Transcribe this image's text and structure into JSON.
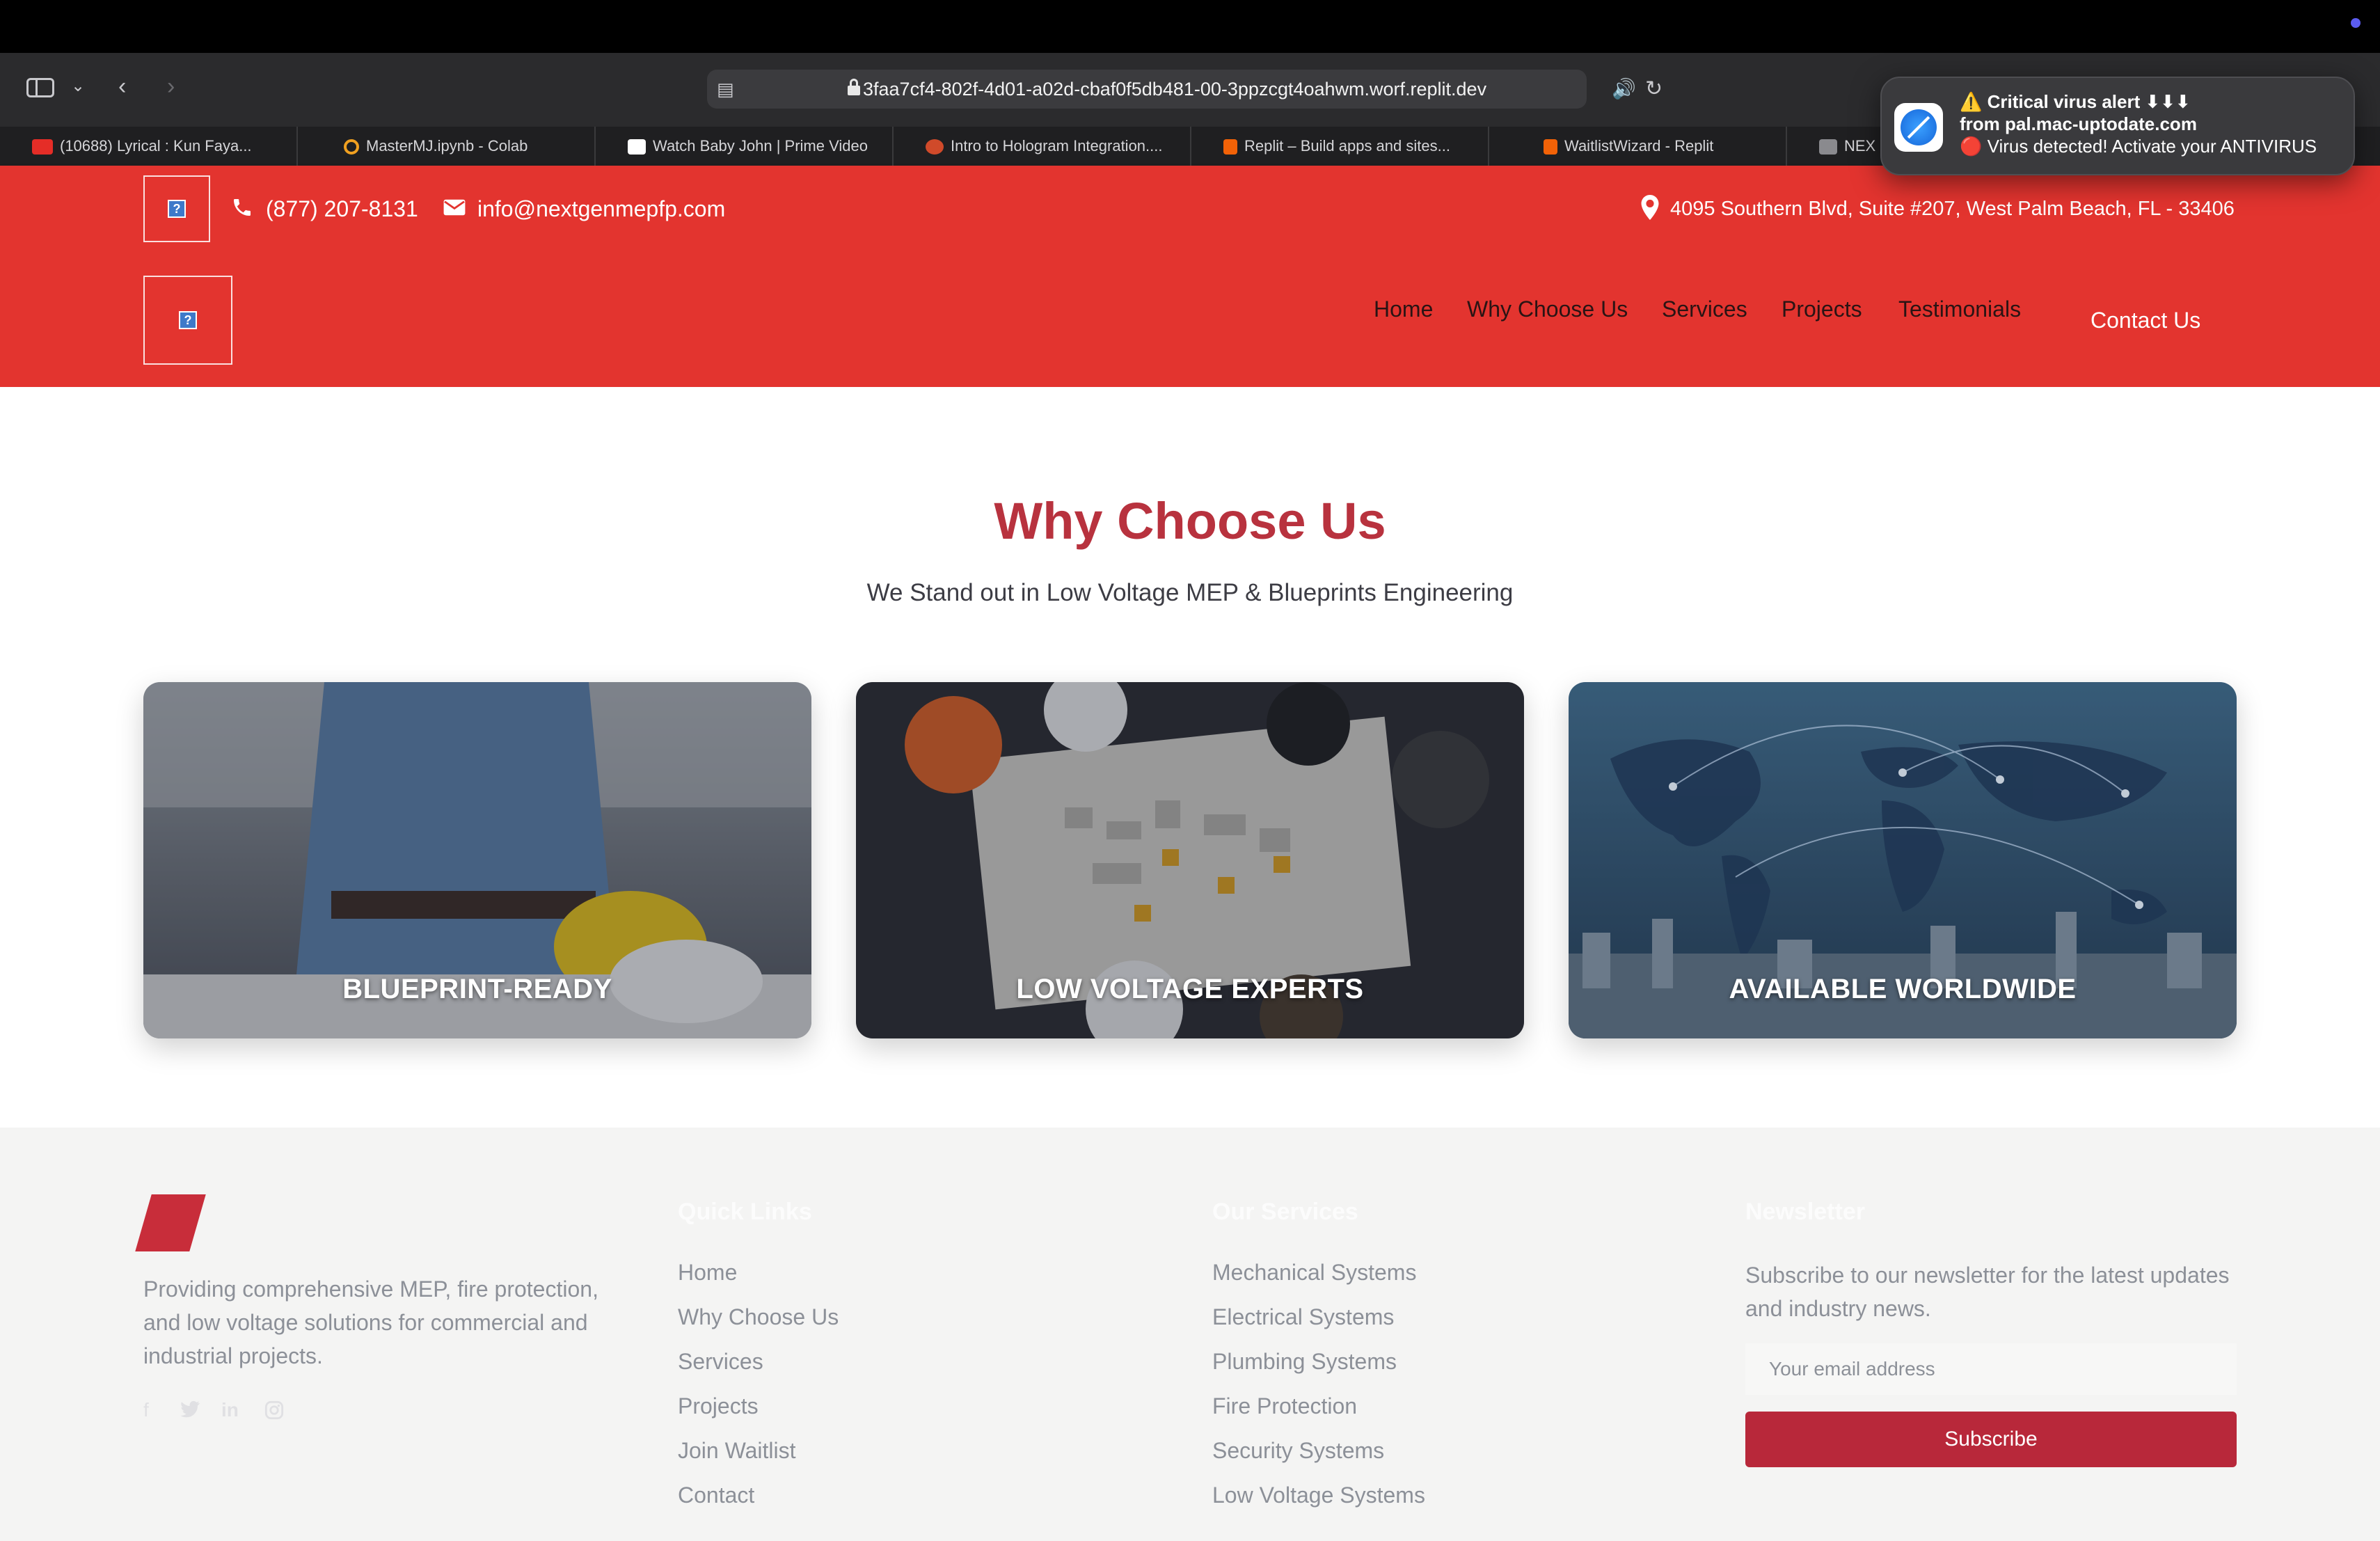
{
  "browser": {
    "url": "3faa7cf4-802f-4d01-a02d-cbaf0f5db481-00-3ppzcgt4oahwm.worf.replit.dev",
    "tabs": [
      {
        "label": "(10688) Lyrical : Kun Faya...",
        "favicon": "youtube-icon"
      },
      {
        "label": "MasterMJ.ipynb - Colab",
        "favicon": "colab-icon"
      },
      {
        "label": "Watch Baby John | Prime Video",
        "favicon": "amazon-icon"
      },
      {
        "label": "Intro to Hologram Integration....",
        "favicon": "powerpoint-icon"
      },
      {
        "label": "Replit – Build apps and sites...",
        "favicon": "replit-icon"
      },
      {
        "label": "WaitlistWizard - Replit",
        "favicon": "replit-icon"
      },
      {
        "label": "NEX",
        "favicon": "r-icon"
      }
    ]
  },
  "notification": {
    "title": "⚠️ Critical virus alert ⬇⬇⬇",
    "line1": "from pal.mac-uptodate.com",
    "line2": "🔴 Virus detected! Activate your ANTIVIRUS"
  },
  "header": {
    "phone": "(877) 207-8131",
    "email": "info@nextgenmepfp.com",
    "address": "4095 Southern Blvd, Suite #207, West Palm Beach, FL - 33406",
    "nav": [
      "Home",
      "Why Choose Us",
      "Services",
      "Projects",
      "Testimonials"
    ],
    "contact_label": "Contact Us",
    "brand_color": "#e3342f"
  },
  "main": {
    "title": "Why Choose Us",
    "subtitle": "We Stand out in Low Voltage MEP & Blueprints Engineering",
    "cards": [
      {
        "label": "BLUEPRINT-READY"
      },
      {
        "label": "LOW VOLTAGE EXPERTS"
      },
      {
        "label": "AVAILABLE WORLDWIDE"
      }
    ]
  },
  "footer": {
    "description": "Providing comprehensive MEP, fire protection, and low voltage solutions for commercial and industrial projects.",
    "quick_links_heading": "Quick Links",
    "quick_links": [
      "Home",
      "Why Choose Us",
      "Services",
      "Projects",
      "Join Waitlist",
      "Contact"
    ],
    "services_heading": "Our Services",
    "services": [
      "Mechanical Systems",
      "Electrical Systems",
      "Plumbing Systems",
      "Fire Protection",
      "Security Systems",
      "Low Voltage Systems"
    ],
    "newsletter_heading": "Newsletter",
    "newsletter_text": "Subscribe to our newsletter for the latest updates and industry news.",
    "email_placeholder": "Your email address",
    "subscribe_label": "Subscribe"
  }
}
